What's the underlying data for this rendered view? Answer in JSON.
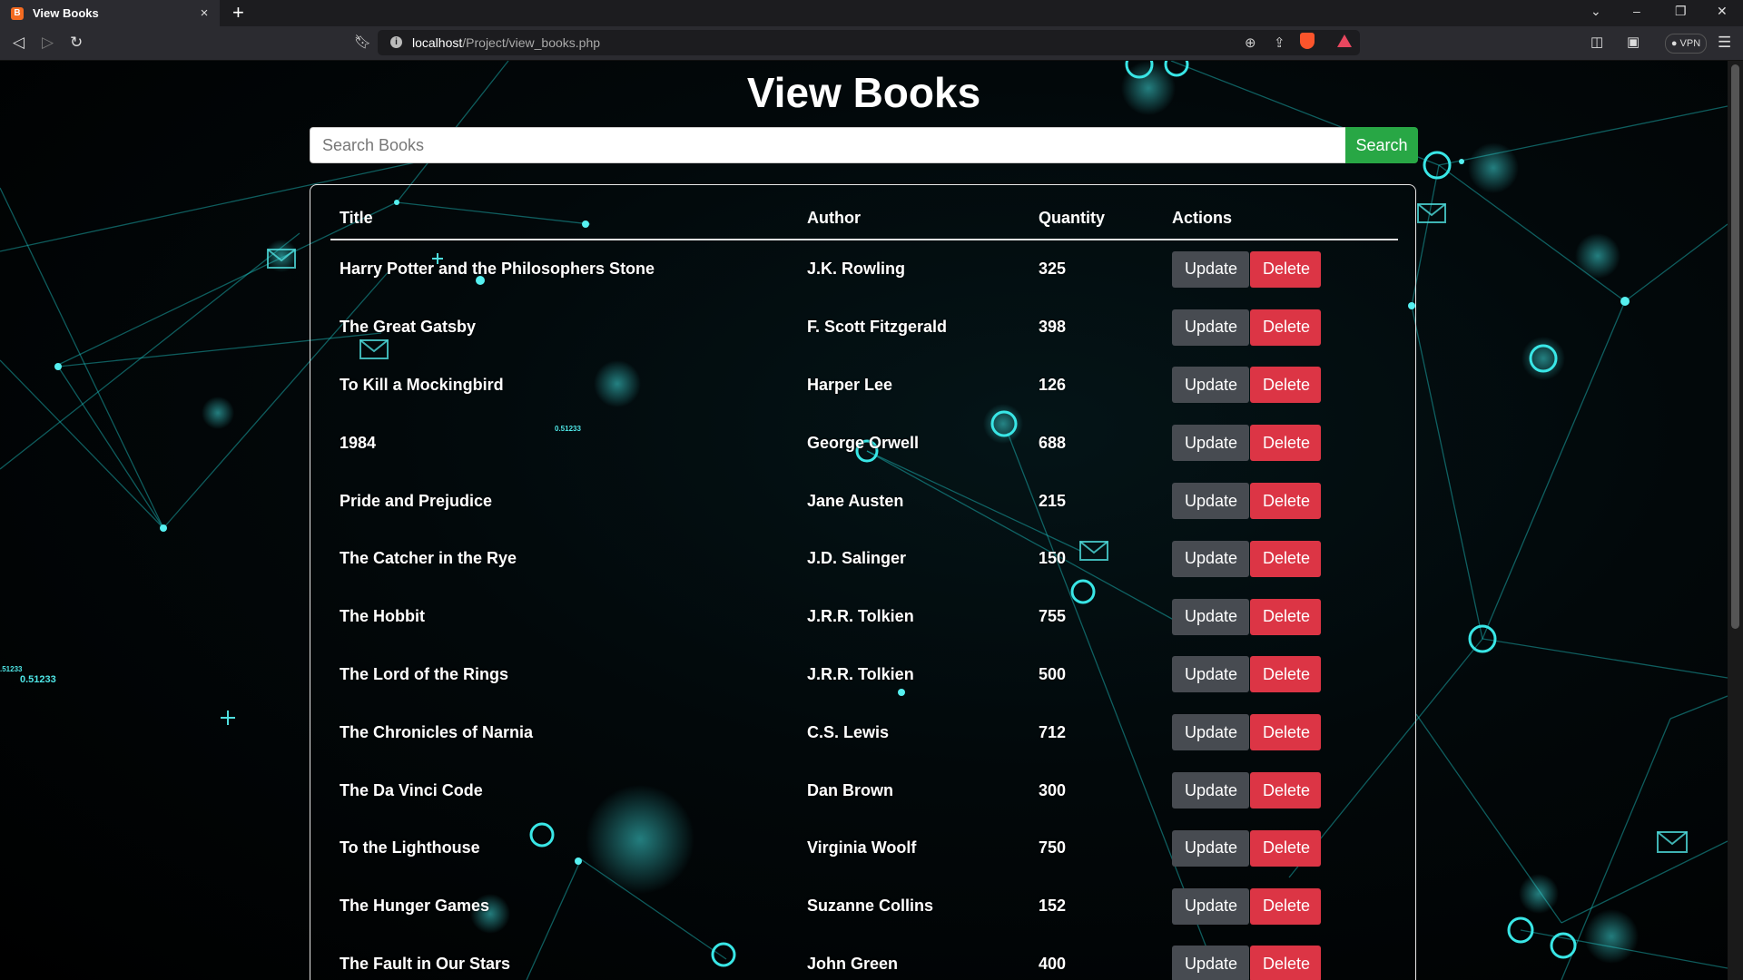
{
  "browser": {
    "tab_title": "View Books",
    "url_host": "localhost",
    "url_path": "/Project/view_books.php",
    "vpn_label": "VPN"
  },
  "page": {
    "title": "View Books",
    "search": {
      "placeholder": "Search Books",
      "button_label": "Search"
    },
    "columns": {
      "title": "Title",
      "author": "Author",
      "quantity": "Quantity",
      "actions": "Actions"
    },
    "update_label": "Update",
    "delete_label": "Delete",
    "books": [
      {
        "title": "Harry Potter and the Philosophers Stone",
        "author": "J.K. Rowling",
        "quantity": "325"
      },
      {
        "title": "The Great Gatsby",
        "author": "F. Scott Fitzgerald",
        "quantity": "398"
      },
      {
        "title": "To Kill a Mockingbird",
        "author": "Harper Lee",
        "quantity": "126"
      },
      {
        "title": "1984",
        "author": "George Orwell",
        "quantity": "688"
      },
      {
        "title": "Pride and Prejudice",
        "author": "Jane Austen",
        "quantity": "215"
      },
      {
        "title": "The Catcher in the Rye",
        "author": "J.D. Salinger",
        "quantity": "150"
      },
      {
        "title": "The Hobbit",
        "author": "J.R.R. Tolkien",
        "quantity": "755"
      },
      {
        "title": "The Lord of the Rings",
        "author": "J.R.R. Tolkien",
        "quantity": "500"
      },
      {
        "title": "The Chronicles of Narnia",
        "author": "C.S. Lewis",
        "quantity": "712"
      },
      {
        "title": "The Da Vinci Code",
        "author": "Dan Brown",
        "quantity": "300"
      },
      {
        "title": "To the Lighthouse",
        "author": "Virginia Woolf",
        "quantity": "750"
      },
      {
        "title": "The Hunger Games",
        "author": "Suzanne Collins",
        "quantity": "152"
      },
      {
        "title": "The Fault in Our Stars",
        "author": "John Green",
        "quantity": "400"
      }
    ]
  },
  "background": {
    "floating_numbers": [
      "0.51233",
      "0.51233",
      ".51233"
    ]
  },
  "colors": {
    "accent": "#28a745",
    "danger": "#dc3545",
    "secondary": "#474b51",
    "network": "#1fc8c8"
  }
}
